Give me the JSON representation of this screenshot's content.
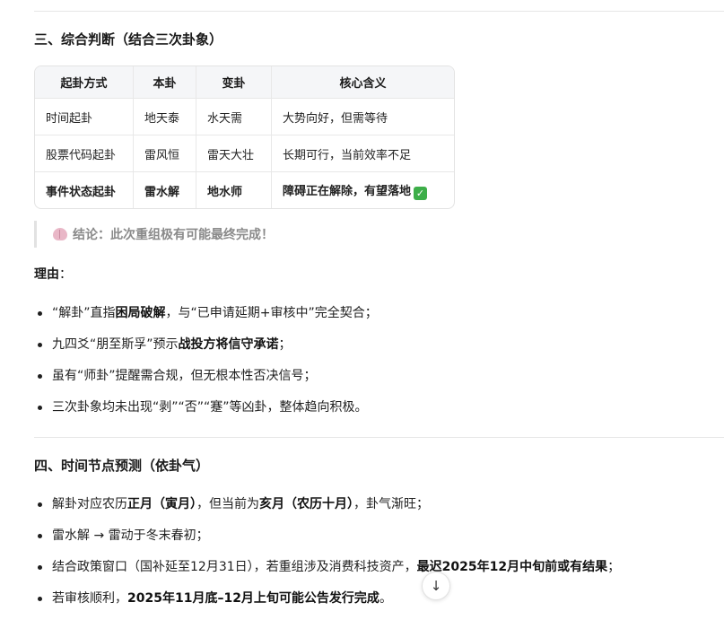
{
  "section3": {
    "title": "三、综合判断（结合三次卦象）",
    "table": {
      "headers": [
        "起卦方式",
        "本卦",
        "变卦",
        "核心含义"
      ],
      "rows": [
        [
          "时间起卦",
          "地天泰",
          "水天需",
          "大势向好，但需等待"
        ],
        [
          "股票代码起卦",
          "雷风恒",
          "雷天大壮",
          "长期可行，当前效率不足"
        ],
        [
          "事件状态起卦",
          "雷水解",
          "地水师",
          "障碍正在解除，有望落地"
        ]
      ],
      "check_icon": "green-check-emoji"
    },
    "conclusion": "结论：此次重组极有可能最终完成！",
    "conclusion_icon": "brain-icon",
    "reason_label": "理由",
    "reason_colon": "：",
    "reasons": [
      {
        "t1": "“解卦”直指",
        "b1": "困局破解",
        "t2": "，与“已申请延期+审核中”完全契合；"
      },
      {
        "t1": "九四爻“朋至斯孚”预示",
        "b1": "战投方将信守承诺",
        "t2": "；"
      },
      {
        "t1": "虽有“师卦”提醒需合规，但无根本性否决信号；"
      },
      {
        "t1": "三次卦象均未出现“剥”“否”“蹇”等凶卦，整体趋向积极。"
      }
    ]
  },
  "section4": {
    "title": "四、时间节点预测（依卦气）",
    "items": [
      {
        "t1": "解卦对应农历",
        "b1": "正月（寅月）",
        "t2": "，但当前为",
        "b2": "亥月（农历十月）",
        "t3": "，卦气渐旺；"
      },
      {
        "t1": "雷水解 → 雷动于冬末春初；"
      },
      {
        "t1": "结合政策窗口（国补延至12月31日），若重组涉及消费科技资产，",
        "b1": "最迟2025年12月中旬前或有结果",
        "t2": "；"
      },
      {
        "t1": "若审核顺利，",
        "b1": "2025年11月底–12月上旬可能公告发行完成",
        "t2": "。"
      }
    ]
  },
  "scroll_button": {
    "icon": "arrow-down-icon",
    "glyph": "↓"
  }
}
